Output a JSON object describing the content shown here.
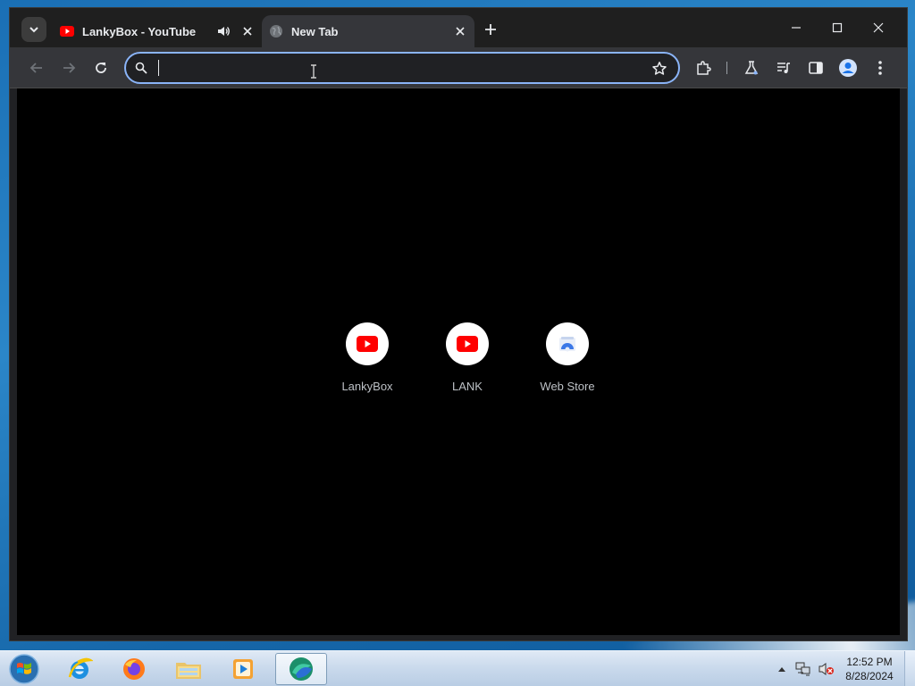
{
  "browser": {
    "tabs": [
      {
        "title": "LankyBox - YouTube",
        "favicon": "youtube-icon",
        "audio": true
      },
      {
        "title": "New Tab",
        "favicon": "globe-icon",
        "active": true
      }
    ],
    "omnibox": {
      "value": "",
      "placeholder": ""
    },
    "shortcuts": [
      {
        "label": "LankyBox",
        "icon": "youtube-icon"
      },
      {
        "label": "LANK",
        "icon": "youtube-icon"
      },
      {
        "label": "Web Store",
        "icon": "web-store-icon"
      }
    ],
    "colors": {
      "accent": "#8ab4f8",
      "youtube_red": "#ff0000"
    }
  },
  "taskbar": {
    "apps": [
      "internet-explorer-icon",
      "firefox-icon",
      "file-explorer-icon",
      "media-player-icon",
      "browser-app-icon"
    ],
    "clock": {
      "time": "12:52 PM",
      "date": "8/28/2024"
    }
  }
}
